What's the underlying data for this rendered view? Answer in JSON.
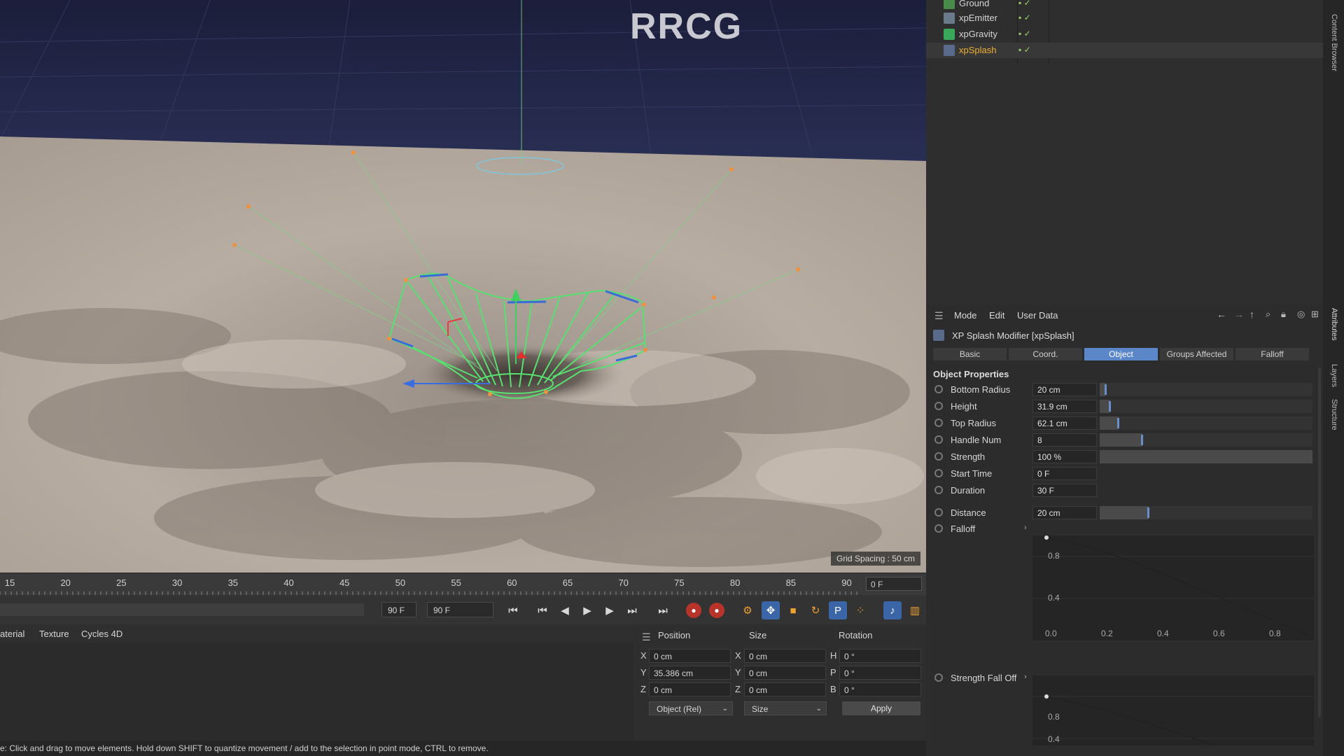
{
  "viewport": {
    "watermark_title": "RRCG",
    "grid_spacing": "Grid Spacing : 50 cm"
  },
  "timeline": {
    "ticks": [
      "15",
      "20",
      "25",
      "30",
      "35",
      "40",
      "45",
      "50",
      "55",
      "60",
      "65",
      "70",
      "75",
      "80",
      "85",
      "90"
    ],
    "current_frame": "0 F"
  },
  "transport": {
    "end_frame_a": "90 F",
    "end_frame_b": "90 F",
    "buttons": [
      "go-to-start",
      "prev-keyframe",
      "prev-frame",
      "play",
      "next-frame",
      "next-keyframe",
      "go-to-end",
      "record",
      "autokey",
      "keyframe-selection",
      "move",
      "scale",
      "rotate",
      "parameter",
      "point-level",
      "motion-system",
      "timeline"
    ]
  },
  "material_bar": {
    "tabs": [
      "aterial",
      "Texture",
      "Cycles 4D"
    ]
  },
  "coordinates": {
    "headers": {
      "position": "Position",
      "size": "Size",
      "rotation": "Rotation"
    },
    "rows": [
      {
        "axis": "X",
        "pos": "0 cm",
        "size_axis": "X",
        "size": "0 cm",
        "rot_axis": "H",
        "rot": "0 °"
      },
      {
        "axis": "Y",
        "pos": "35.386 cm",
        "size_axis": "Y",
        "size": "0 cm",
        "rot_axis": "P",
        "rot": "0 °"
      },
      {
        "axis": "Z",
        "pos": "0 cm",
        "size_axis": "Z",
        "size": "0 cm",
        "rot_axis": "B",
        "rot": "0 °"
      }
    ],
    "mode_dropdown": "Object (Rel)",
    "size_dropdown": "Size",
    "apply_label": "Apply"
  },
  "status_bar": {
    "text": "e: Click and drag to move elements. Hold down SHIFT to quantize movement / add to the selection in point mode, CTRL to remove."
  },
  "object_manager": {
    "objects": [
      {
        "name": "Ground",
        "icon": "ground-icon",
        "selected": false
      },
      {
        "name": "xpEmitter",
        "icon": "emitter-icon",
        "selected": false
      },
      {
        "name": "xpGravity",
        "icon": "gravity-icon",
        "selected": false
      },
      {
        "name": "xpSplash",
        "icon": "splash-icon",
        "selected": true
      }
    ]
  },
  "attributes": {
    "menu": [
      "Mode",
      "Edit",
      "User Data"
    ],
    "title": "XP Splash Modifier [xpSplash]",
    "tabs": [
      "Basic",
      "Coord.",
      "Object",
      "Groups Affected",
      "Falloff"
    ],
    "active_tab": "Object",
    "section": "Object Properties",
    "params": [
      {
        "label": "Bottom Radius",
        "value": "20 cm",
        "level": 0.03
      },
      {
        "label": "Height",
        "value": "31.9 cm",
        "level": 0.05
      },
      {
        "label": "Top Radius",
        "value": "62.1 cm",
        "level": 0.09
      },
      {
        "label": "Handle Num",
        "value": "8",
        "level": 0.2
      },
      {
        "label": "Strength",
        "value": "100 %",
        "level": 1.0
      },
      {
        "label": "Start Time",
        "value": "0 F",
        "level": null
      },
      {
        "label": "Duration",
        "value": "30 F",
        "level": null
      },
      {
        "label": "Distance",
        "value": "20 cm",
        "level": 0.23
      },
      {
        "label": "Falloff",
        "value": "",
        "level": null
      },
      {
        "label": "Strength Fall Off",
        "value": "",
        "level": null
      }
    ],
    "falloff_graph": {
      "y_ticks": [
        "0.8",
        "0.4"
      ],
      "x_ticks": [
        "0.0",
        "0.2",
        "0.4",
        "0.6",
        "0.8"
      ]
    },
    "strength_graph": {
      "y_ticks": [
        "0.8",
        "0.4"
      ]
    },
    "side_tabs": [
      "Content Browser",
      "Attributes",
      "Layers",
      "Structure"
    ]
  },
  "colors": {
    "accent": "#5b86c8",
    "selected_object": "#f0b030",
    "splash_wire": "#58e070"
  }
}
